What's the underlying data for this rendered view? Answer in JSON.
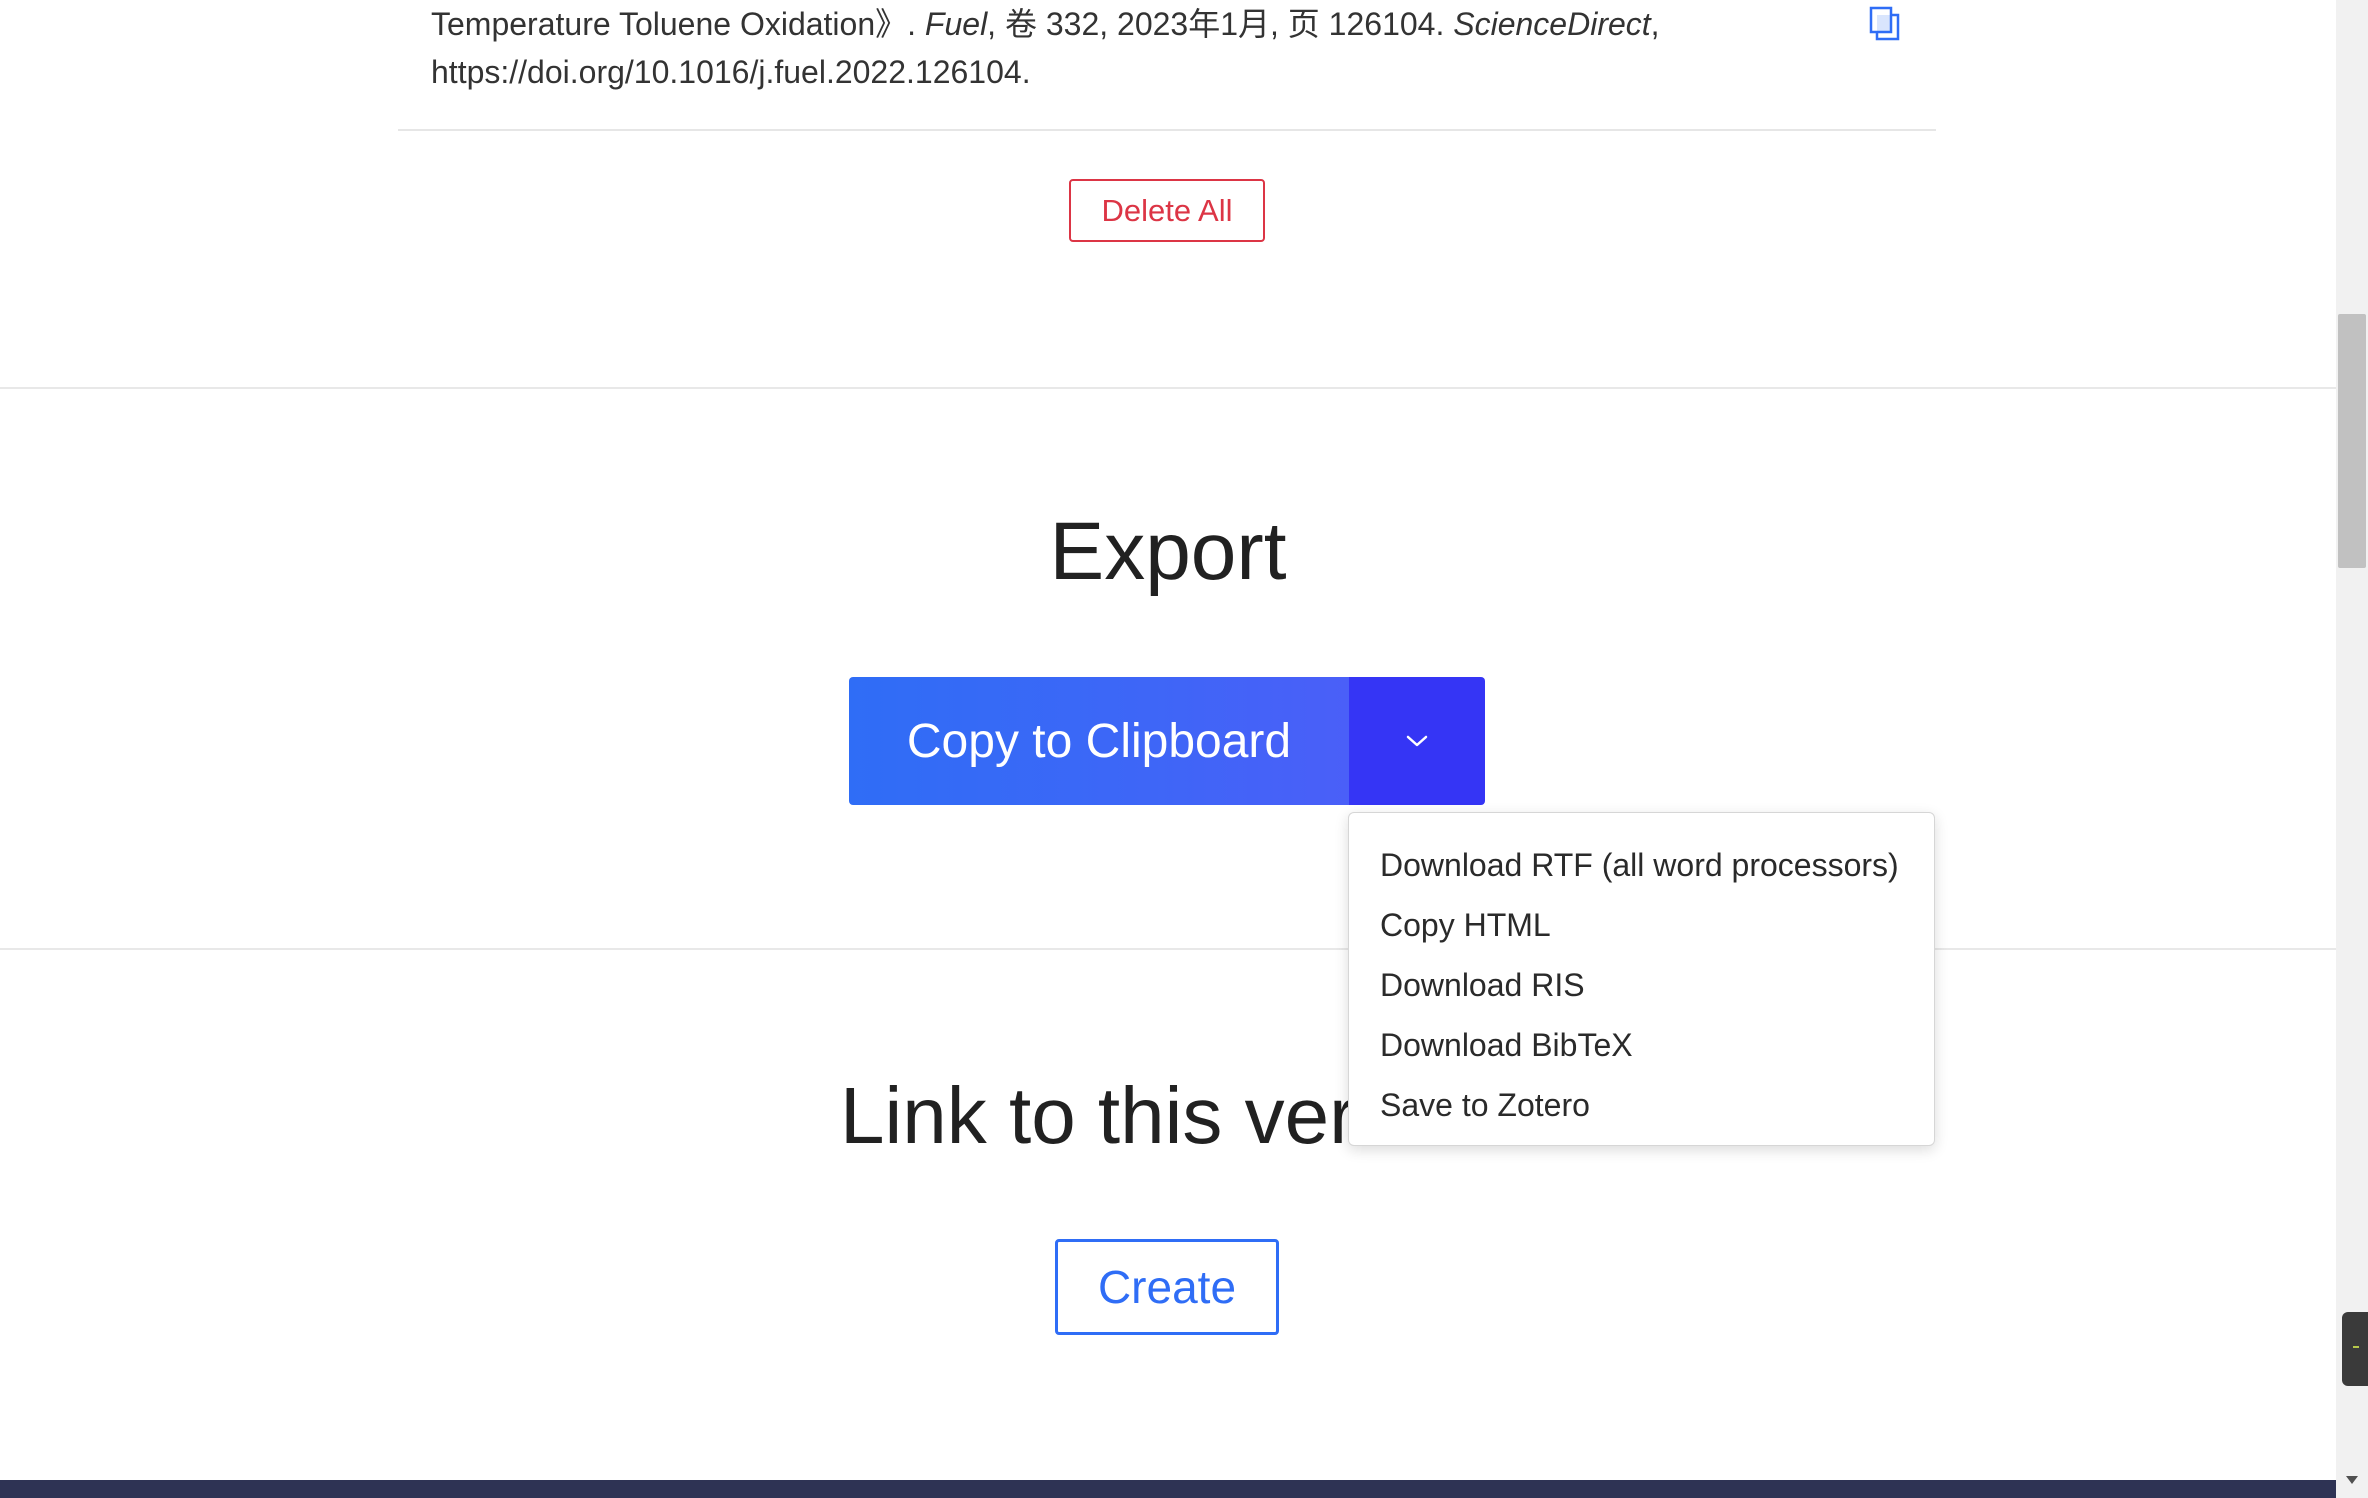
{
  "citation": {
    "line1_prefix": "Temperature Toluene Oxidation》. ",
    "journal": "Fuel",
    "line1_mid": ", 卷 332, 2023年1月, 页 126104. ",
    "source": "ScienceDirect",
    "line1_suffix": ",",
    "line2": "https://doi.org/10.1016/j.fuel.2022.126104."
  },
  "icons": {
    "copy_entry": "copy-icon",
    "caret": "chevron-down-icon",
    "scroll_down": "triangle-down-icon"
  },
  "actions": {
    "delete_all": "Delete All"
  },
  "export": {
    "title": "Export",
    "copy_button": "Copy to Clipboard",
    "menu": [
      "Download RTF (all word processors)",
      "Copy HTML",
      "Download RIS",
      "Download BibTeX",
      "Save to Zotero"
    ]
  },
  "link": {
    "title": "Link to this vers",
    "create_button": "Create"
  },
  "colors": {
    "primary": "#2f6df6",
    "caret_bg": "#3535f5",
    "danger": "#dc3545",
    "footer": "#2e3354"
  }
}
